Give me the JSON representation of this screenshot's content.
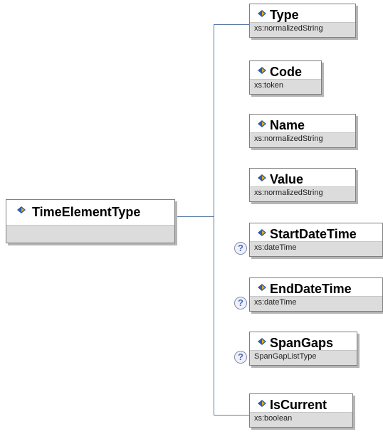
{
  "root": {
    "name": "TimeElementType"
  },
  "elements": [
    {
      "name": "Type",
      "type": "xs:normalizedString",
      "optional": false
    },
    {
      "name": "Code",
      "type": "xs:token",
      "optional": false
    },
    {
      "name": "Name",
      "type": "xs:normalizedString",
      "optional": false
    },
    {
      "name": "Value",
      "type": "xs:normalizedString",
      "optional": false
    },
    {
      "name": "StartDateTime",
      "type": "xs:dateTime",
      "optional": true
    },
    {
      "name": "EndDateTime",
      "type": "xs:dateTime",
      "optional": true
    },
    {
      "name": "SpanGaps",
      "type": "SpanGapListType",
      "optional": true
    },
    {
      "name": "IsCurrent",
      "type": "xs:boolean",
      "optional": false
    }
  ],
  "optional_marker": "?",
  "colors": {
    "connector": "#5a7aa6",
    "icon_blue": "#2f5ea8",
    "icon_gold": "#e8a814"
  }
}
